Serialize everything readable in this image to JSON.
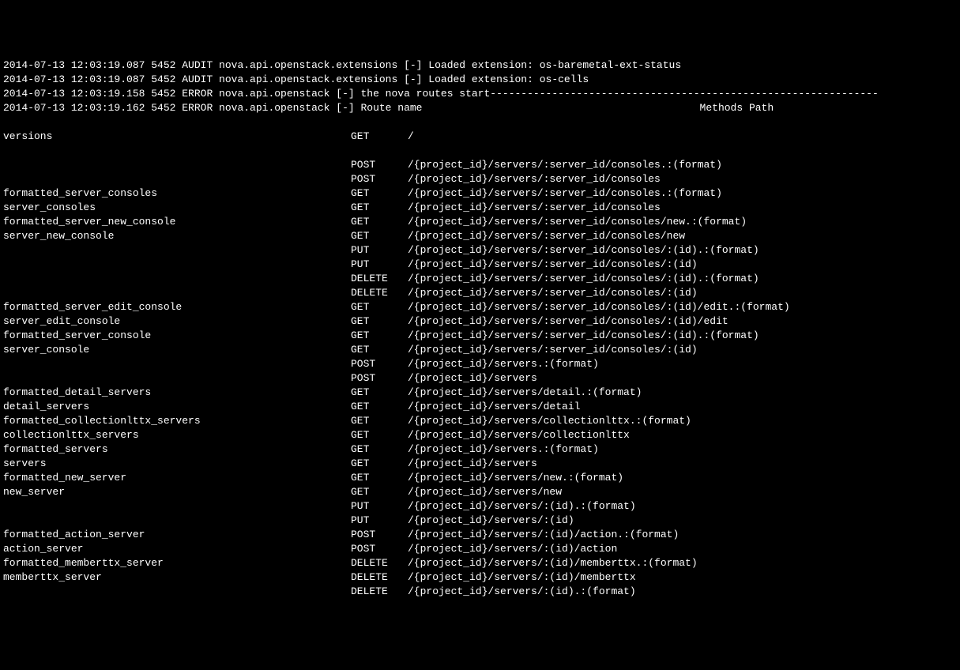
{
  "log_lines": [
    "2014-07-13 12:03:19.087 5452 AUDIT nova.api.openstack.extensions [-] Loaded extension: os-baremetal-ext-status",
    "2014-07-13 12:03:19.087 5452 AUDIT nova.api.openstack.extensions [-] Loaded extension: os-cells",
    "2014-07-13 12:03:19.158 5452 ERROR nova.api.openstack [-] the nova routes start---------------------------------------------------------------",
    "2014-07-13 12:03:19.162 5452 ERROR nova.api.openstack [-] Route name                                             Methods Path"
  ],
  "routes": [
    {
      "name": "",
      "method": "",
      "path": ""
    },
    {
      "name": "versions",
      "method": "GET",
      "path": "/"
    },
    {
      "name": "",
      "method": "",
      "path": ""
    },
    {
      "name": "",
      "method": "POST",
      "path": "/{project_id}/servers/:server_id/consoles.:(format)"
    },
    {
      "name": "",
      "method": "POST",
      "path": "/{project_id}/servers/:server_id/consoles"
    },
    {
      "name": "formatted_server_consoles",
      "method": "GET",
      "path": "/{project_id}/servers/:server_id/consoles.:(format)"
    },
    {
      "name": "server_consoles",
      "method": "GET",
      "path": "/{project_id}/servers/:server_id/consoles"
    },
    {
      "name": "formatted_server_new_console",
      "method": "GET",
      "path": "/{project_id}/servers/:server_id/consoles/new.:(format)"
    },
    {
      "name": "server_new_console",
      "method": "GET",
      "path": "/{project_id}/servers/:server_id/consoles/new"
    },
    {
      "name": "",
      "method": "PUT",
      "path": "/{project_id}/servers/:server_id/consoles/:(id).:(format)"
    },
    {
      "name": "",
      "method": "PUT",
      "path": "/{project_id}/servers/:server_id/consoles/:(id)"
    },
    {
      "name": "",
      "method": "DELETE",
      "path": "/{project_id}/servers/:server_id/consoles/:(id).:(format)"
    },
    {
      "name": "",
      "method": "DELETE",
      "path": "/{project_id}/servers/:server_id/consoles/:(id)"
    },
    {
      "name": "formatted_server_edit_console",
      "method": "GET",
      "path": "/{project_id}/servers/:server_id/consoles/:(id)/edit.:(format)"
    },
    {
      "name": "server_edit_console",
      "method": "GET",
      "path": "/{project_id}/servers/:server_id/consoles/:(id)/edit"
    },
    {
      "name": "formatted_server_console",
      "method": "GET",
      "path": "/{project_id}/servers/:server_id/consoles/:(id).:(format)"
    },
    {
      "name": "server_console",
      "method": "GET",
      "path": "/{project_id}/servers/:server_id/consoles/:(id)"
    },
    {
      "name": "",
      "method": "POST",
      "path": "/{project_id}/servers.:(format)"
    },
    {
      "name": "",
      "method": "POST",
      "path": "/{project_id}/servers"
    },
    {
      "name": "formatted_detail_servers",
      "method": "GET",
      "path": "/{project_id}/servers/detail.:(format)"
    },
    {
      "name": "detail_servers",
      "method": "GET",
      "path": "/{project_id}/servers/detail"
    },
    {
      "name": "formatted_collectionlttx_servers",
      "method": "GET",
      "path": "/{project_id}/servers/collectionlttx.:(format)"
    },
    {
      "name": "collectionlttx_servers",
      "method": "GET",
      "path": "/{project_id}/servers/collectionlttx"
    },
    {
      "name": "formatted_servers",
      "method": "GET",
      "path": "/{project_id}/servers.:(format)"
    },
    {
      "name": "servers",
      "method": "GET",
      "path": "/{project_id}/servers"
    },
    {
      "name": "formatted_new_server",
      "method": "GET",
      "path": "/{project_id}/servers/new.:(format)"
    },
    {
      "name": "new_server",
      "method": "GET",
      "path": "/{project_id}/servers/new"
    },
    {
      "name": "",
      "method": "PUT",
      "path": "/{project_id}/servers/:(id).:(format)"
    },
    {
      "name": "",
      "method": "PUT",
      "path": "/{project_id}/servers/:(id)"
    },
    {
      "name": "formatted_action_server",
      "method": "POST",
      "path": "/{project_id}/servers/:(id)/action.:(format)"
    },
    {
      "name": "action_server",
      "method": "POST",
      "path": "/{project_id}/servers/:(id)/action"
    },
    {
      "name": "formatted_memberttx_server",
      "method": "DELETE",
      "path": "/{project_id}/servers/:(id)/memberttx.:(format)"
    },
    {
      "name": "memberttx_server",
      "method": "DELETE",
      "path": "/{project_id}/servers/:(id)/memberttx"
    },
    {
      "name": "",
      "method": "DELETE",
      "path": "/{project_id}/servers/:(id).:(format)"
    }
  ]
}
